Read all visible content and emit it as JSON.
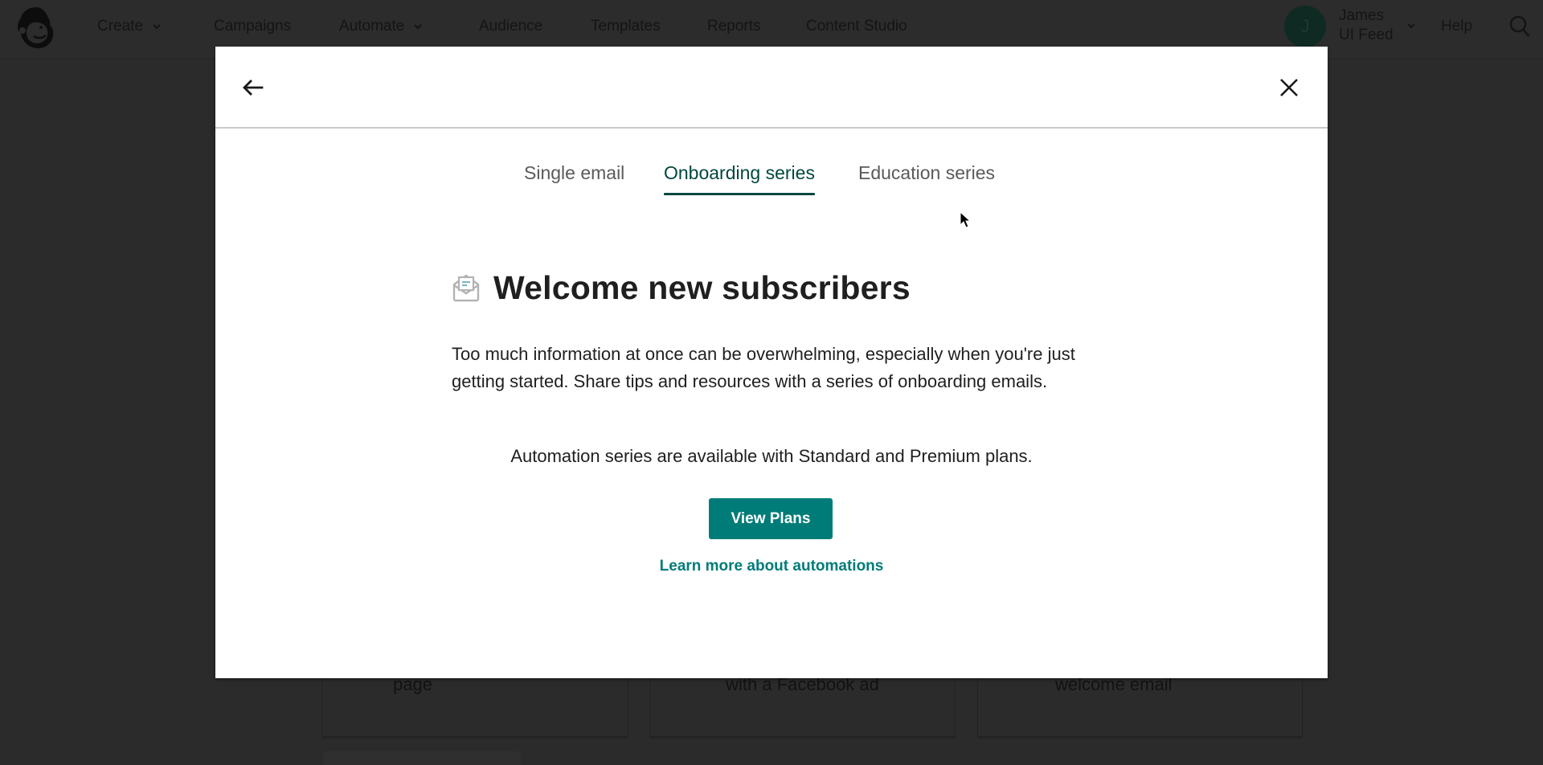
{
  "nav": {
    "logo": "mailchimp-freddie-logo",
    "items": [
      {
        "label": "Create",
        "has_dropdown": true
      },
      {
        "label": "Campaigns",
        "has_dropdown": false
      },
      {
        "label": "Automate",
        "has_dropdown": true
      },
      {
        "label": "Audience",
        "has_dropdown": false
      },
      {
        "label": "Templates",
        "has_dropdown": false
      },
      {
        "label": "Reports",
        "has_dropdown": false
      },
      {
        "label": "Content Studio",
        "has_dropdown": false
      }
    ],
    "user": {
      "initial": "J",
      "name_line1": "James",
      "name_line2": "UI Feed"
    },
    "help_label": "Help",
    "search_icon": "search-icon"
  },
  "background_cards": [
    {
      "label_tail": "page"
    },
    {
      "label_tail": "with a Facebook ad"
    },
    {
      "label_tail": "welcome email"
    }
  ],
  "modal": {
    "back_icon": "arrow-left-icon",
    "close_icon": "close-icon",
    "tabs": [
      {
        "label": "Single email",
        "active": false
      },
      {
        "label": "Onboarding series",
        "active": true
      },
      {
        "label": "Education series",
        "active": false
      }
    ],
    "heading_icon": "open-envelope-icon",
    "heading": "Welcome new subscribers",
    "description": "Too much information at once can be overwhelming, especially when you're just getting started. Share tips and resources with a series of onboarding emails.",
    "plans_note": "Automation series are available with Standard and Premium plans.",
    "primary_button": "View Plans",
    "link": "Learn more about automations"
  },
  "colors": {
    "accent": "#007c78",
    "tab_active": "#00473f",
    "overlay": "#2b2b2b"
  }
}
